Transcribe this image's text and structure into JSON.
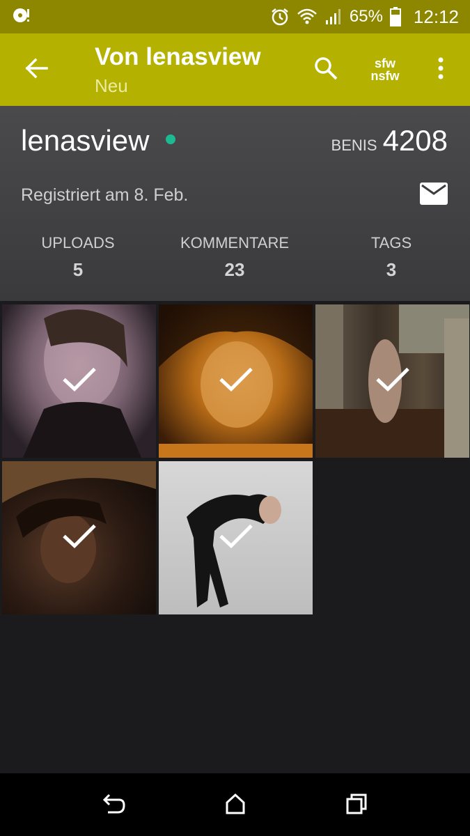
{
  "status_bar": {
    "battery": "65%",
    "time": "12:12"
  },
  "header": {
    "title": "Von lenasview",
    "subtitle": "Neu",
    "sfw_label": "sfw",
    "nsfw_label": "nsfw"
  },
  "profile": {
    "username": "lenasview",
    "benis_label": "BENIS",
    "benis_value": "4208",
    "registered": "Registriert am 8. Feb.",
    "stats": [
      {
        "label": "UPLOADS",
        "value": "5"
      },
      {
        "label": "KOMMENTARE",
        "value": "23"
      },
      {
        "label": "TAGS",
        "value": "3"
      }
    ]
  },
  "uploads": [
    {
      "seen": true
    },
    {
      "seen": true
    },
    {
      "seen": true
    },
    {
      "seen": true
    },
    {
      "seen": true
    }
  ],
  "colors": {
    "accent": "#b4b100",
    "status_bar": "#8d8700",
    "online": "#1db992",
    "background": "#1b1b1d"
  },
  "icons": [
    "back-arrow-icon",
    "search-icon",
    "more-vert-icon",
    "mail-icon",
    "check-icon",
    "nav-back-icon",
    "nav-home-icon",
    "nav-recents-icon"
  ]
}
